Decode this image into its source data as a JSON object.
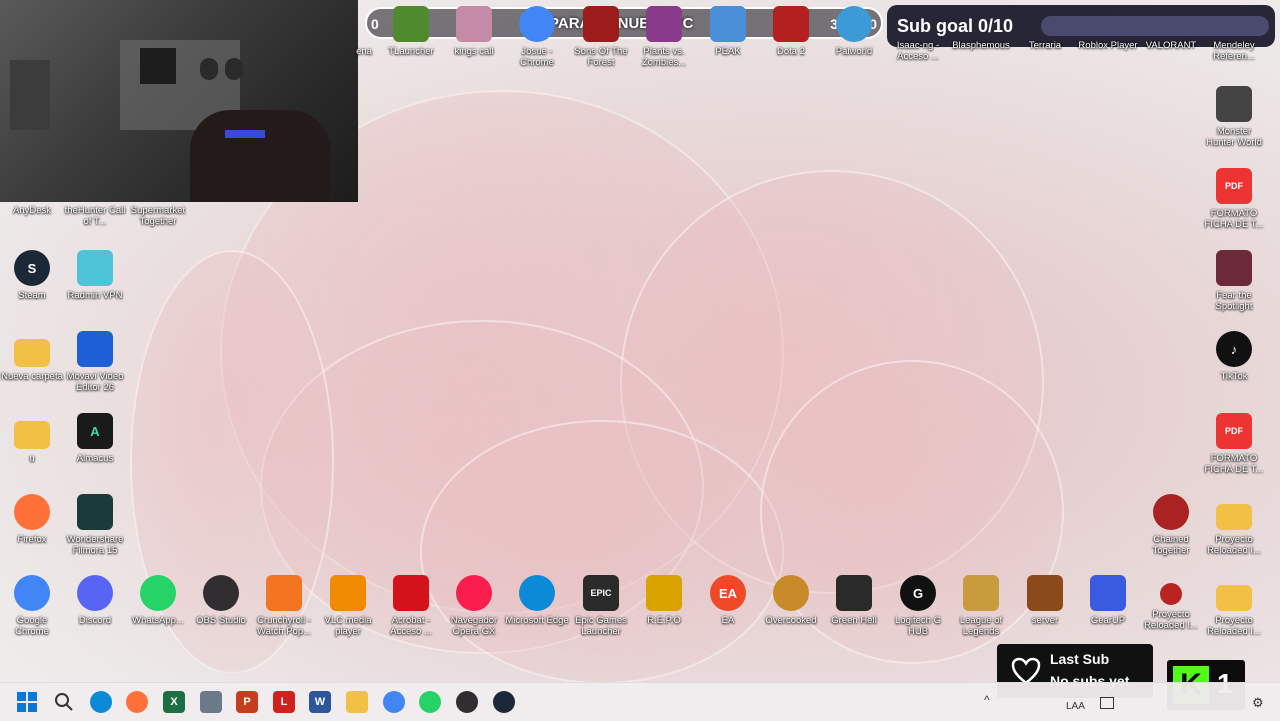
{
  "overlay": {
    "goal_left_value": "0",
    "goal_title": "PARA LA NUEVA PC",
    "goal_right_value": "300000",
    "subgoal_label": "Sub goal 0/10",
    "last_sub_title": "Last Sub",
    "last_sub_value": "No subs yet",
    "kick_count": "1"
  },
  "top_icons": [
    {
      "label": "ena",
      "color": "#7b4a2d"
    },
    {
      "label": "TLauncher",
      "color": "#4f8a2f"
    },
    {
      "label": "kings call",
      "color": "#c58aa8"
    },
    {
      "label": "Josue - Chrome",
      "color": "#4285f4"
    },
    {
      "label": "Sons Of The Forest",
      "color": "#9c1b1b"
    },
    {
      "label": "Plants vs. Zombies...",
      "color": "#8a3a8a"
    },
    {
      "label": "PEAK",
      "color": "#4a90d9"
    },
    {
      "label": "Dota 2",
      "color": "#b3201f"
    },
    {
      "label": "Palworld",
      "color": "#3c9bd6"
    },
    {
      "label": "Isaac-ng - Acceso ...",
      "color": "#2b2b2b"
    },
    {
      "label": "Blasphemous",
      "color": "#5a2a2a"
    },
    {
      "label": "Terraria",
      "color": "#3f8a3f"
    },
    {
      "label": "Roblox Player",
      "color": "#222"
    },
    {
      "label": "VALORANT",
      "color": "#ff4655"
    },
    {
      "label": "Mendeley Referen...",
      "color": "#a51f36"
    }
  ],
  "left_icons": [
    {
      "label": "AnyDesk",
      "color": "#ef443b"
    },
    {
      "label": "theHunter Call of T...",
      "color": "#6b5a3a"
    },
    {
      "label": "Supermarket Together",
      "color": "#d9a84a"
    },
    {
      "label": "Steam",
      "color": "#1b2838"
    },
    {
      "label": "Radmin VPN",
      "color": "#4fc3d8"
    },
    {
      "label": "Nueva carpeta",
      "color": "#f2c045"
    },
    {
      "label": "Movavi Video Editor 26",
      "color": "#1f5fd6"
    },
    {
      "label": "u",
      "color": "#f2c045"
    },
    {
      "label": "Almacus",
      "color": "#1a1a1a"
    },
    {
      "label": "Firefox",
      "color": "#ff7139"
    },
    {
      "label": "Wondershare Filmora 15",
      "color": "#1a3b3b"
    }
  ],
  "bottom_icons": [
    {
      "label": "Google Chrome",
      "color": "#4285f4"
    },
    {
      "label": "Discord",
      "color": "#5865f2"
    },
    {
      "label": "WhatsApp...",
      "color": "#25d366"
    },
    {
      "label": "OBS Studio",
      "color": "#302e31"
    },
    {
      "label": "Crunchyroll - Watch Pop...",
      "color": "#f47521"
    },
    {
      "label": "VLC media player",
      "color": "#f08a00"
    },
    {
      "label": "Acrobat - Acceso ...",
      "color": "#d4121b"
    },
    {
      "label": "Navegador Opera GX",
      "color": "#fa1e4e"
    },
    {
      "label": "Microsoft Edge",
      "color": "#0c8ad8"
    },
    {
      "label": "Epic Games Launcher",
      "color": "#2a2a2a"
    },
    {
      "label": "R.E.P.O",
      "color": "#d9a400"
    },
    {
      "label": "EA",
      "color": "#ef4a28"
    },
    {
      "label": "Overcooked",
      "color": "#c98a2a"
    },
    {
      "label": "Green Hell",
      "color": "#2a2a2a"
    },
    {
      "label": "Logitech G HUB",
      "color": "#111"
    },
    {
      "label": "League of Legends",
      "color": "#c89b3c"
    },
    {
      "label": "server",
      "color": "#8a4a1a"
    },
    {
      "label": "GearUP",
      "color": "#3a5adf"
    },
    {
      "label": "Proyecto Reloaded I...",
      "color": "#b22"
    },
    {
      "label": "Proyecto Reloaded I...",
      "color": "#f2c045"
    }
  ],
  "right_icons": [
    {
      "label": "Monster Hunter World",
      "color": "#444"
    },
    {
      "label": "FORMATO FICHA DE T...",
      "color": "#e33"
    },
    {
      "label": "Fear the Spotlight",
      "color": "#6a2a3a"
    },
    {
      "label": "TikTok",
      "color": "#111"
    },
    {
      "label": "FORMATO FICHA DE T...",
      "color": "#e33"
    },
    {
      "label": "Chained Together",
      "color": "#a22"
    },
    {
      "label": "Proyecto Reloaded I...",
      "color": "#f2c045"
    }
  ],
  "taskbar": {
    "tray_lang": "LAA"
  }
}
